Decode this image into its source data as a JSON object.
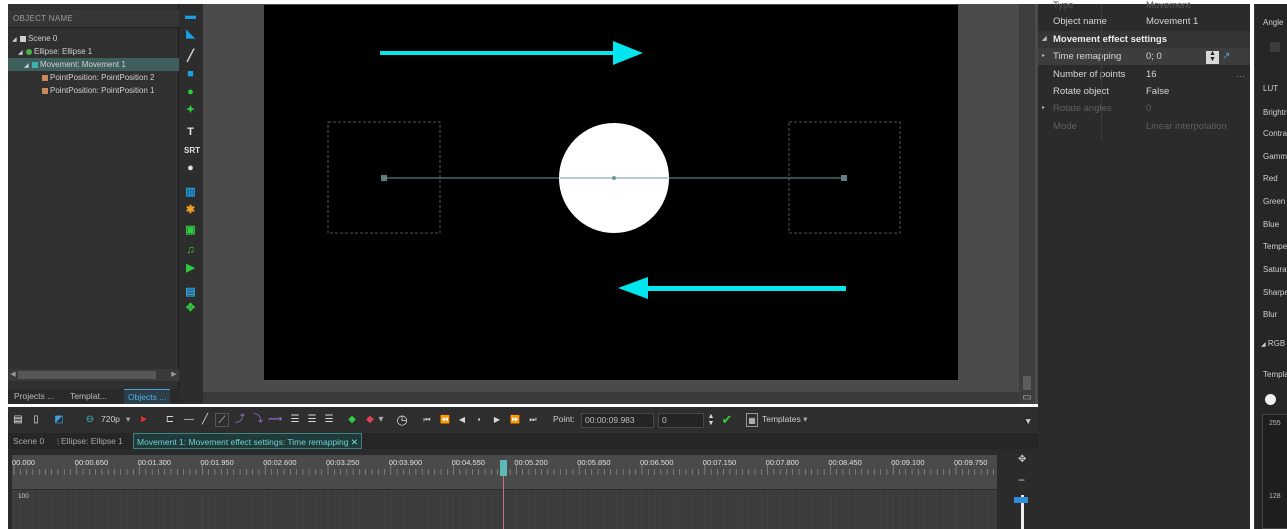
{
  "tree": {
    "header": "OBJECT NAME",
    "items": [
      {
        "label": "Scene 0"
      },
      {
        "label": "Ellipse: Ellipse 1"
      },
      {
        "label": "Movement: Movement 1"
      },
      {
        "label": "PointPosition: PointPosition 2"
      },
      {
        "label": "PointPosition: PointPosition 1"
      }
    ]
  },
  "panel_tabs": [
    "Projects ...",
    "Templat...",
    "Objects ..."
  ],
  "properties": {
    "rows": [
      {
        "label": "Object name",
        "value": "Movement 1"
      },
      {
        "label": "Movement effect settings",
        "value": ""
      },
      {
        "label": "Time remapping",
        "value": "0; 0"
      },
      {
        "label": "Number of points",
        "value": "16"
      },
      {
        "label": "Rotate object",
        "value": "False"
      },
      {
        "label": "Rotate angles",
        "value": "0"
      },
      {
        "label": "Mode",
        "value": "Linear interpolation"
      }
    ]
  },
  "right_panel": {
    "labels": [
      "Angle",
      "LUT",
      "Brightness",
      "Contrast",
      "Gamma",
      "Red",
      "Green",
      "Blue",
      "Temperature",
      "Saturation",
      "Sharpen",
      "Blur",
      "RGB",
      "Template"
    ],
    "values": [
      "255",
      "128"
    ]
  },
  "toolbar": {
    "resolution": "720p",
    "point_label": "Point:",
    "point_time": "00:00:09.983",
    "point_value": "0",
    "templates_label": "Templates"
  },
  "breadcrumb": [
    "Scene 0",
    "Ellipse: Ellipse 1",
    "Movement 1: Movement effect settings: Time remapping"
  ],
  "timeline": {
    "ticks": [
      "00.000",
      "00:00.650",
      "00:01.300",
      "00:01.950",
      "00:02.600",
      "00:03.250",
      "00:03.900",
      "00:04.550",
      "00:05.200",
      "00:05.850",
      "00:06.500",
      "00:07.150",
      "00:07.800",
      "00:08.450",
      "00:09.100",
      "00:09.750"
    ],
    "track_value": "100"
  },
  "colors": {
    "arrow": "#00e5ee",
    "accent": "#4fa5d6",
    "canvas": "#000000",
    "selection": "#3f5f5f"
  }
}
